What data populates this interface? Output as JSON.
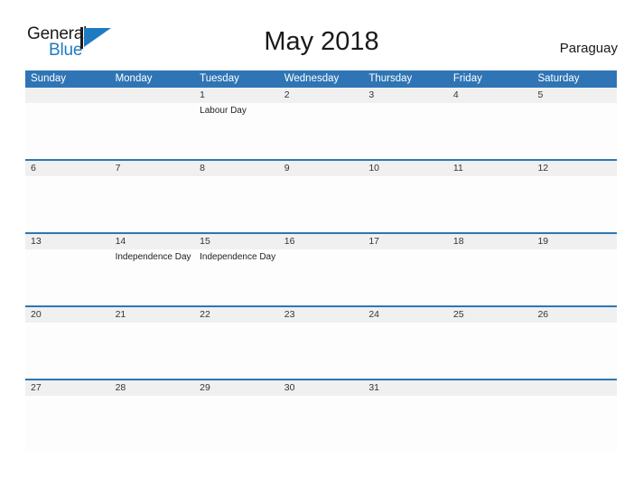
{
  "brand": {
    "name_part1": "General",
    "name_part2": "Blue",
    "mark": "triangle-logo"
  },
  "header": {
    "title": "May 2018",
    "country": "Paraguay"
  },
  "calendar": {
    "weekdays": [
      "Sunday",
      "Monday",
      "Tuesday",
      "Wednesday",
      "Thursday",
      "Friday",
      "Saturday"
    ],
    "accent_color": "#2f75b5",
    "daynum_band_color": "#f0f0f0",
    "weeks": [
      {
        "days": [
          {
            "num": "",
            "event": ""
          },
          {
            "num": "",
            "event": ""
          },
          {
            "num": "1",
            "event": "Labour Day"
          },
          {
            "num": "2",
            "event": ""
          },
          {
            "num": "3",
            "event": ""
          },
          {
            "num": "4",
            "event": ""
          },
          {
            "num": "5",
            "event": ""
          }
        ]
      },
      {
        "days": [
          {
            "num": "6",
            "event": ""
          },
          {
            "num": "7",
            "event": ""
          },
          {
            "num": "8",
            "event": ""
          },
          {
            "num": "9",
            "event": ""
          },
          {
            "num": "10",
            "event": ""
          },
          {
            "num": "11",
            "event": ""
          },
          {
            "num": "12",
            "event": ""
          }
        ]
      },
      {
        "days": [
          {
            "num": "13",
            "event": ""
          },
          {
            "num": "14",
            "event": "Independence Day"
          },
          {
            "num": "15",
            "event": "Independence Day"
          },
          {
            "num": "16",
            "event": ""
          },
          {
            "num": "17",
            "event": ""
          },
          {
            "num": "18",
            "event": ""
          },
          {
            "num": "19",
            "event": ""
          }
        ]
      },
      {
        "days": [
          {
            "num": "20",
            "event": ""
          },
          {
            "num": "21",
            "event": ""
          },
          {
            "num": "22",
            "event": ""
          },
          {
            "num": "23",
            "event": ""
          },
          {
            "num": "24",
            "event": ""
          },
          {
            "num": "25",
            "event": ""
          },
          {
            "num": "26",
            "event": ""
          }
        ]
      },
      {
        "days": [
          {
            "num": "27",
            "event": ""
          },
          {
            "num": "28",
            "event": ""
          },
          {
            "num": "29",
            "event": ""
          },
          {
            "num": "30",
            "event": ""
          },
          {
            "num": "31",
            "event": ""
          },
          {
            "num": "",
            "event": ""
          },
          {
            "num": "",
            "event": ""
          }
        ]
      }
    ]
  }
}
